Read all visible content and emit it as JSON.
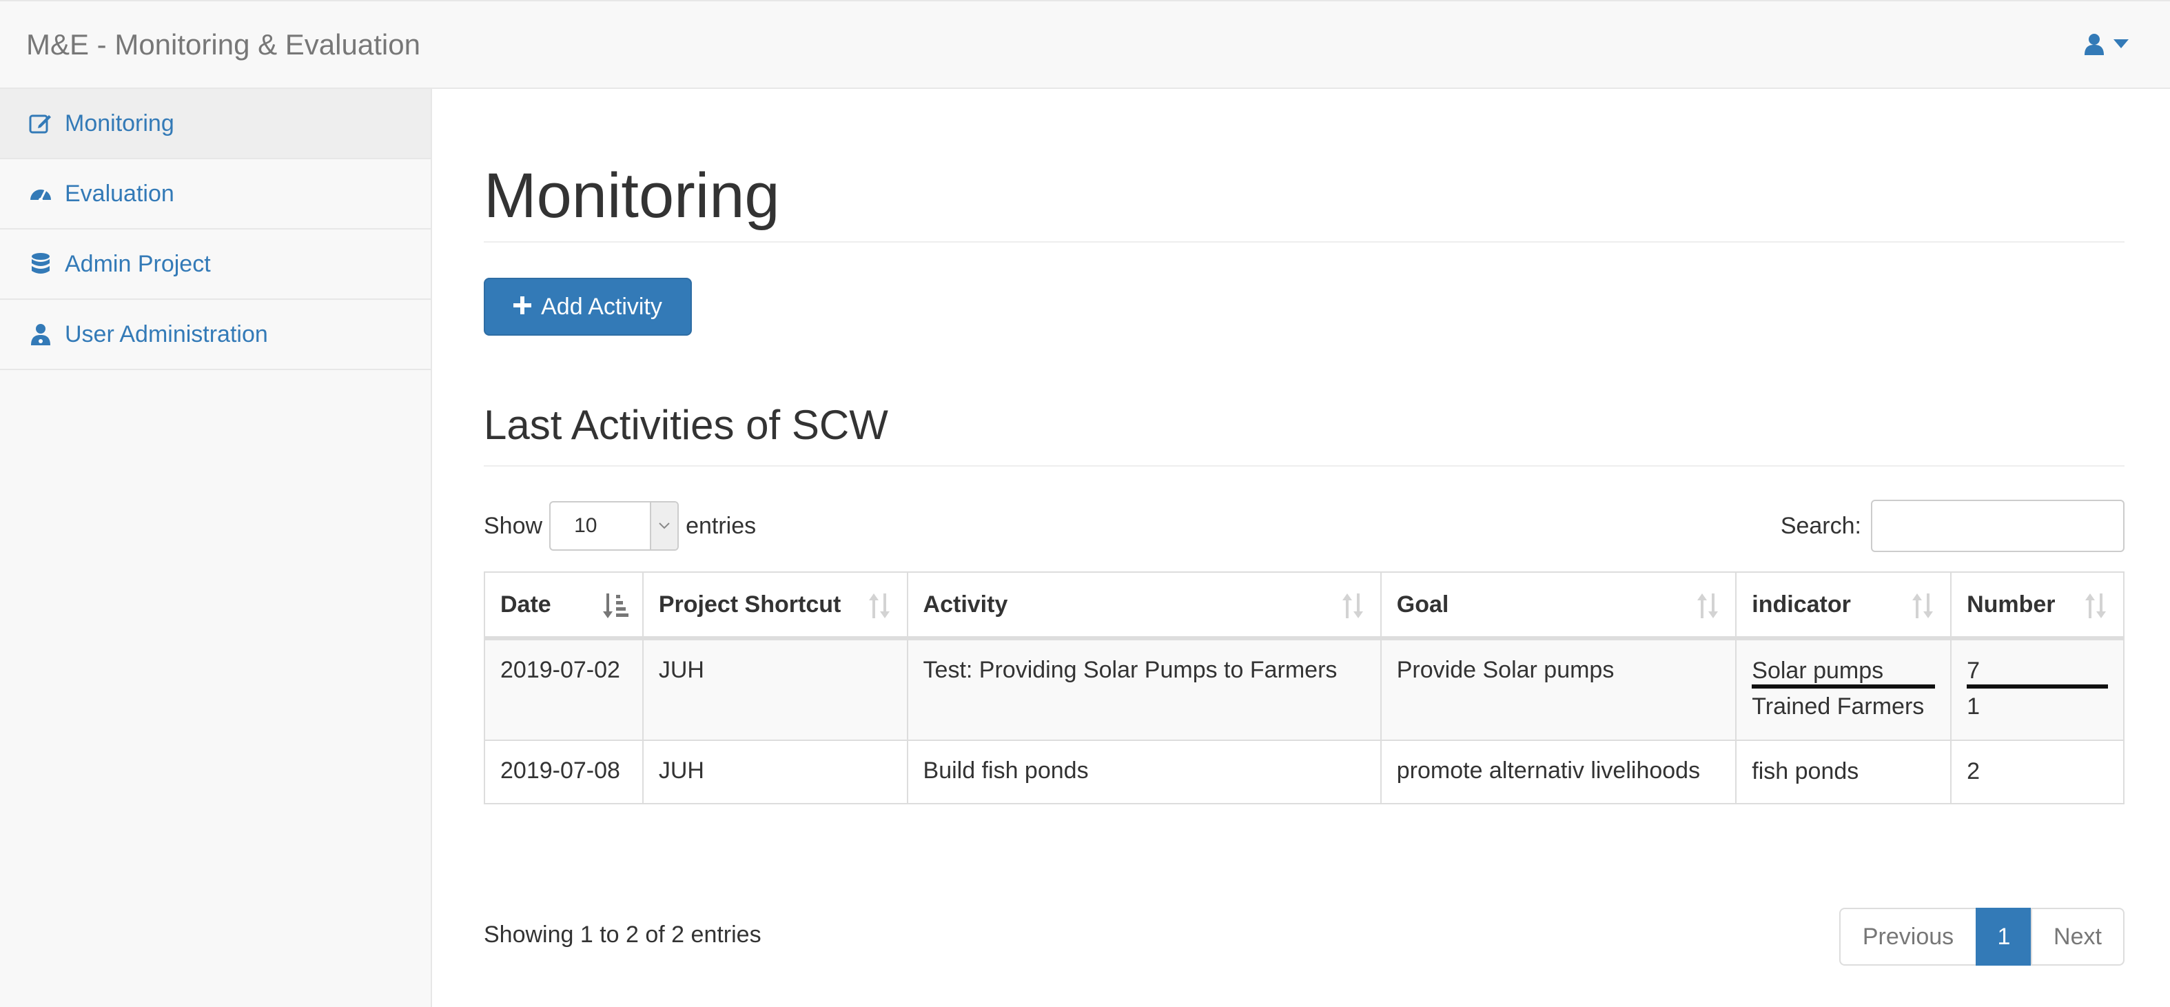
{
  "app": {
    "brand": "M&E - Monitoring & Evaluation"
  },
  "colors": {
    "accent": "#337ab7",
    "navbar_bg": "#f8f8f8",
    "border": "#dddddd"
  },
  "user_menu": {
    "icon": "user-icon",
    "caret_icon": "caret-down-icon"
  },
  "sidebar": {
    "items": [
      {
        "label": "Monitoring",
        "icon": "edit-icon",
        "active": true
      },
      {
        "label": "Evaluation",
        "icon": "dashboard-icon",
        "active": false
      },
      {
        "label": "Admin Project",
        "icon": "database-icon",
        "active": false
      },
      {
        "label": "User Administration",
        "icon": "user-md-icon",
        "active": false
      }
    ]
  },
  "main": {
    "title": "Monitoring",
    "add_button": {
      "label": "Add Activity",
      "icon": "plus-icon"
    },
    "section_title": "Last Activities of SCW",
    "length": {
      "show": "Show",
      "value": "10",
      "entries": "entries"
    },
    "search": {
      "label": "Search:",
      "value": ""
    },
    "table": {
      "columns": [
        "Date",
        "Project Shortcut",
        "Activity",
        "Goal",
        "indicator",
        "Number"
      ],
      "rows": [
        {
          "date": "2019-07-02",
          "project": "JUH",
          "activity": "Test: Providing Solar Pumps to Farmers",
          "goal": "Provide Solar pumps",
          "indicator": [
            "Solar pumps",
            "Trained Farmers"
          ],
          "number": [
            "7",
            "1"
          ]
        },
        {
          "date": "2019-07-08",
          "project": "JUH",
          "activity": "Build fish ponds",
          "goal": "promote alternativ livelihoods",
          "indicator": [
            "fish ponds"
          ],
          "number": [
            "2"
          ]
        }
      ]
    },
    "info": "Showing 1 to 2 of 2 entries",
    "pagination": {
      "previous": "Previous",
      "current": "1",
      "next": "Next"
    }
  }
}
